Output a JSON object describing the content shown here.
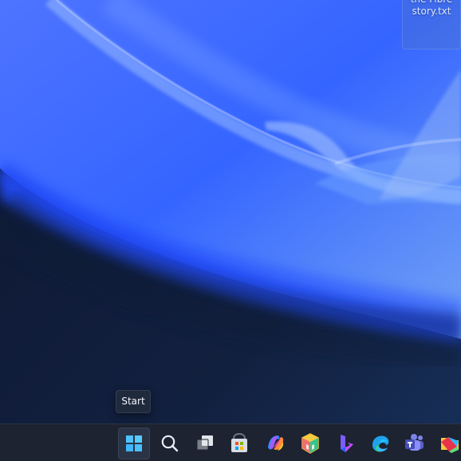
{
  "desktop": {
    "file_label": "the Fibre\nstory.txt"
  },
  "tooltip": {
    "text": "Start"
  },
  "taskbar": {
    "items": [
      {
        "label": "Start",
        "icon": "windows-start-icon"
      },
      {
        "label": "Search",
        "icon": "search-icon"
      },
      {
        "label": "Task View",
        "icon": "task-view-icon"
      },
      {
        "label": "Microsoft Store",
        "icon": "store-icon"
      },
      {
        "label": "Copilot",
        "icon": "copilot-icon"
      },
      {
        "label": "Package App",
        "icon": "package-cube-icon"
      },
      {
        "label": "Bing",
        "icon": "bing-icon"
      },
      {
        "label": "Microsoft Edge",
        "icon": "edge-icon"
      },
      {
        "label": "Microsoft Teams",
        "icon": "teams-icon"
      },
      {
        "label": "Files",
        "icon": "folder-icon"
      }
    ]
  },
  "colors": {
    "taskbar": "#1d2330",
    "tooltip": "#1f2a3d",
    "wallpaper_blue": "#2a57ff",
    "wallpaper_dark": "#121d36"
  }
}
